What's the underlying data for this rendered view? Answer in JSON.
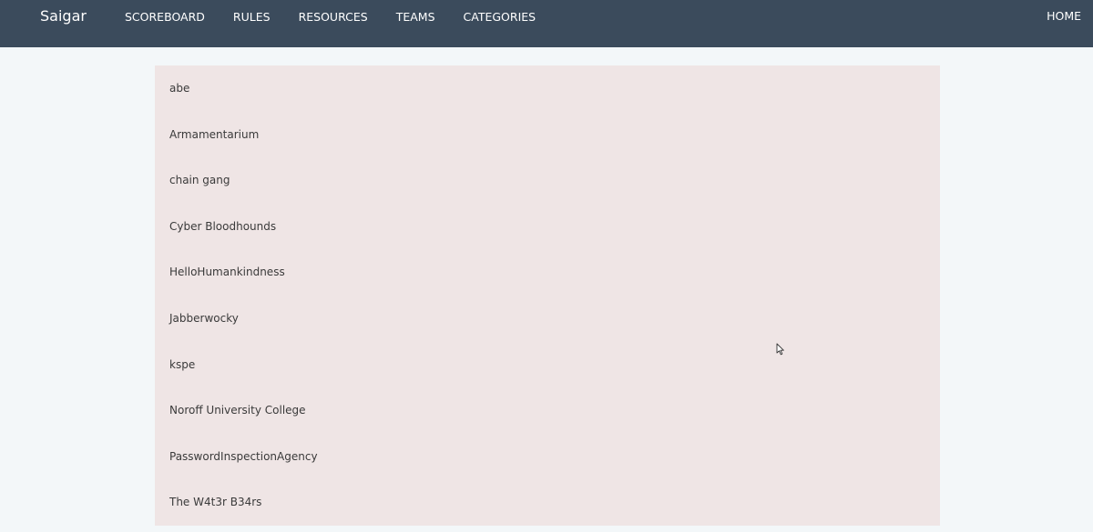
{
  "navbar": {
    "brand": "Saigar",
    "links": [
      "SCOREBOARD",
      "RULES",
      "RESOURCES",
      "TEAMS",
      "CATEGORIES"
    ],
    "right_link": "HOME",
    "color": "#3b4b5c"
  },
  "teams": [
    "abe",
    "Armamentarium",
    "chain gang",
    "Cyber Bloodhounds",
    "HelloHumankindness",
    "Jabberwocky",
    "kspe",
    "Noroff University College",
    "PasswordInspectionAgency",
    "The W4t3r B34rs"
  ],
  "colors": {
    "page_background": "#f3f7f9",
    "panel_background": "#efe5e5"
  },
  "cursor_icon": "mouse-pointer-icon"
}
